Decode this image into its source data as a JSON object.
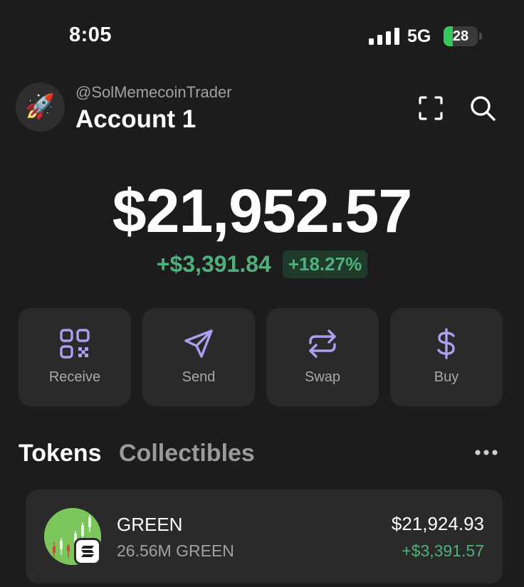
{
  "status_bar": {
    "time": "8:05",
    "network": "5G",
    "battery_level": "28",
    "battery_fraction": 0.28
  },
  "account": {
    "username": "@SolMemecoinTrader",
    "name": "Account 1",
    "avatar_emoji": "🚀"
  },
  "header_icons": {
    "scan": "scan-icon",
    "search": "search-icon"
  },
  "balance": {
    "total": "$21,952.57",
    "change_amount": "+$3,391.84",
    "change_percent": "+18.27%"
  },
  "actions": [
    {
      "label": "Receive",
      "icon": "qr-code-icon"
    },
    {
      "label": "Send",
      "icon": "send-icon"
    },
    {
      "label": "Swap",
      "icon": "swap-icon"
    },
    {
      "label": "Buy",
      "icon": "dollar-icon"
    }
  ],
  "tabs": [
    {
      "label": "Tokens",
      "active": true
    },
    {
      "label": "Collectibles",
      "active": false
    }
  ],
  "tokens": [
    {
      "name": "GREEN",
      "amount": "26.56M GREEN",
      "value": "$21,924.93",
      "change": "+$3,391.57",
      "chain_badge": "solana-badge-icon"
    }
  ],
  "colors": {
    "background": "#1c1c1c",
    "card": "#2a2a2a",
    "accent": "#ab9ff2",
    "positive": "#4fb07a",
    "positive_bg": "#1f3a2a",
    "battery": "#34c759"
  }
}
